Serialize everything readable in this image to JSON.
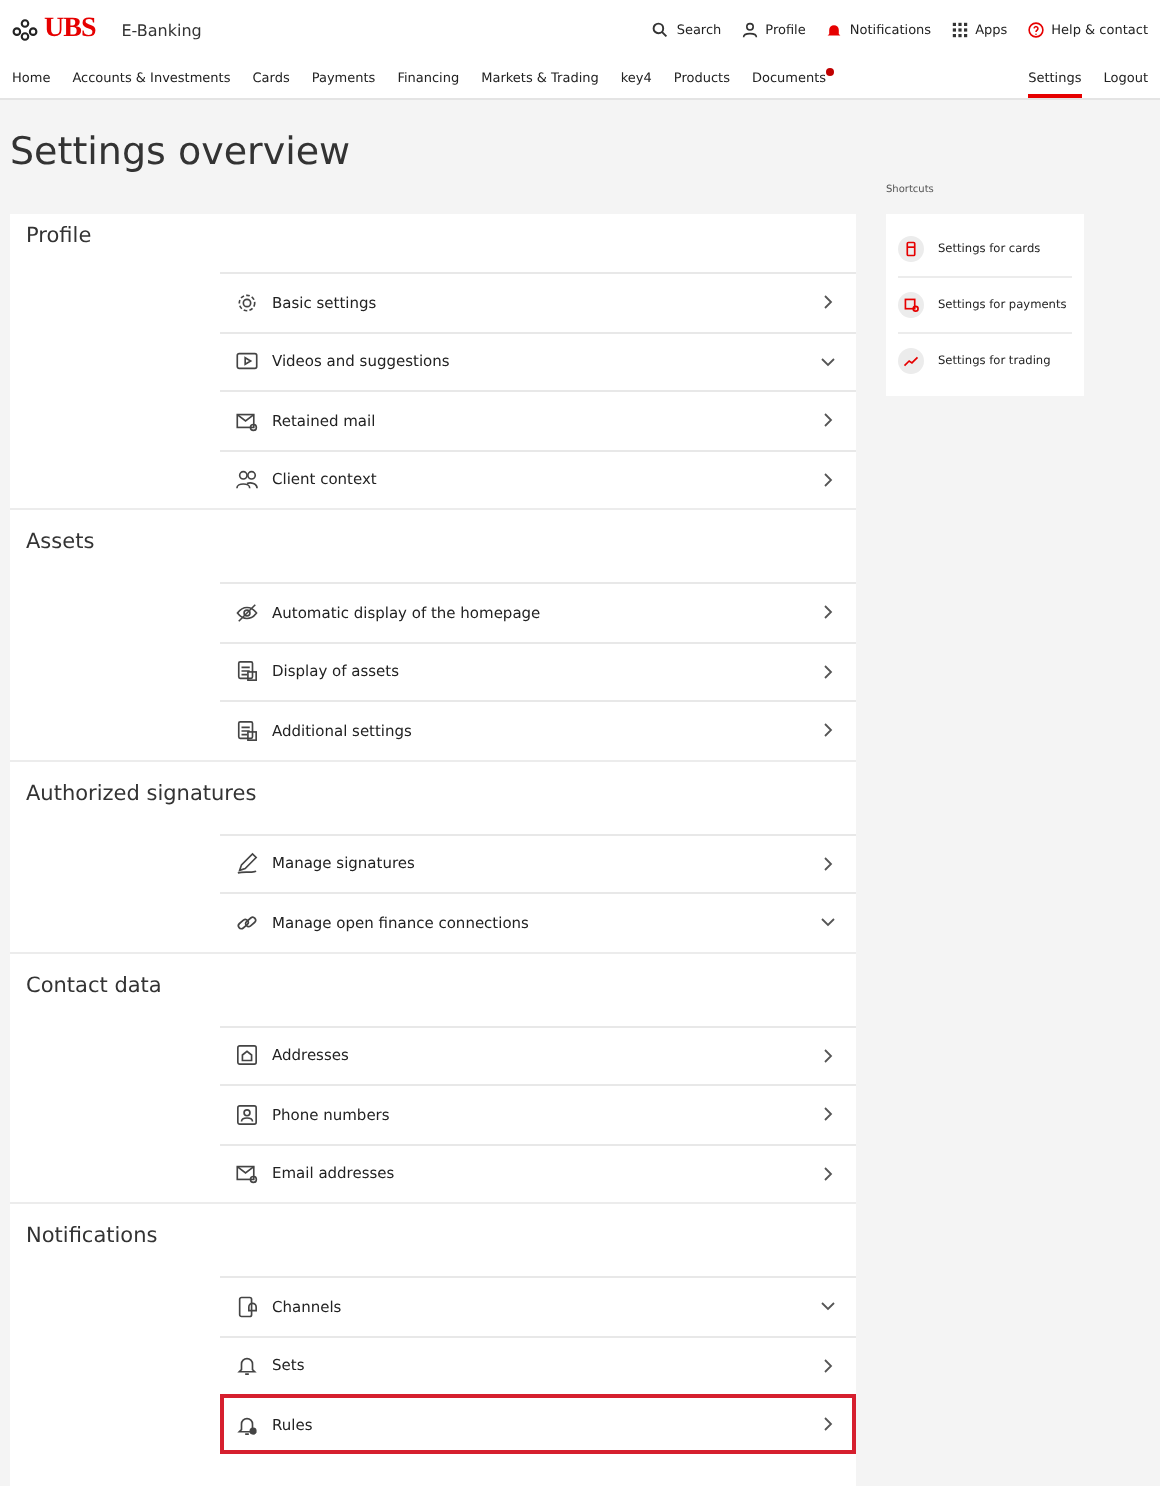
{
  "header": {
    "logo": "UBS",
    "product": "E-Banking",
    "actions": [
      {
        "label": "Search"
      },
      {
        "label": "Profile"
      },
      {
        "label": "Notifications"
      },
      {
        "label": "Apps"
      },
      {
        "label": "Help & contact"
      }
    ]
  },
  "nav": {
    "items": [
      {
        "label": "Home",
        "selected": false,
        "dot": false
      },
      {
        "label": "Accounts & Investments",
        "selected": false,
        "dot": false
      },
      {
        "label": "Cards",
        "selected": false,
        "dot": false
      },
      {
        "label": "Payments",
        "selected": false,
        "dot": false
      },
      {
        "label": "Financing",
        "selected": false,
        "dot": false
      },
      {
        "label": "Markets & Trading",
        "selected": false,
        "dot": false
      },
      {
        "label": "key4",
        "selected": false,
        "dot": false
      },
      {
        "label": "Products",
        "selected": false,
        "dot": false
      },
      {
        "label": "Documents",
        "selected": false,
        "dot": true
      }
    ],
    "right": [
      {
        "label": "Settings",
        "selected": true
      },
      {
        "label": "Logout",
        "selected": false
      }
    ]
  },
  "title": "Settings overview",
  "sections": [
    {
      "heading": "Profile",
      "items": [
        {
          "label": "Basic settings",
          "kind": "link",
          "highlighted": false
        },
        {
          "label": "Videos and suggestions",
          "kind": "expandable",
          "highlighted": false
        },
        {
          "label": "Retained mail",
          "kind": "link",
          "highlighted": false
        },
        {
          "label": "Client context",
          "kind": "link",
          "highlighted": false
        }
      ]
    },
    {
      "heading": "Assets",
      "items": [
        {
          "label": "Automatic display of the homepage",
          "kind": "link",
          "highlighted": false
        },
        {
          "label": "Display of assets",
          "kind": "link",
          "highlighted": false
        },
        {
          "label": "Additional settings",
          "kind": "link",
          "highlighted": false
        }
      ]
    },
    {
      "heading": "Authorized signatures",
      "items": [
        {
          "label": "Manage signatures",
          "kind": "link",
          "highlighted": false
        },
        {
          "label": "Manage open finance connections",
          "kind": "expandable",
          "highlighted": false
        }
      ]
    },
    {
      "heading": "Contact data",
      "items": [
        {
          "label": "Addresses",
          "kind": "link",
          "highlighted": false
        },
        {
          "label": "Phone numbers",
          "kind": "link",
          "highlighted": false
        },
        {
          "label": "Email addresses",
          "kind": "link",
          "highlighted": false
        }
      ]
    },
    {
      "heading": "Notifications",
      "items": [
        {
          "label": "Channels",
          "kind": "expandable",
          "highlighted": false
        },
        {
          "label": "Sets",
          "kind": "link",
          "highlighted": false
        },
        {
          "label": "Rules",
          "kind": "link",
          "highlighted": true
        }
      ]
    }
  ],
  "shortcuts": {
    "heading": "Shortcuts",
    "items": [
      {
        "label": "Settings for cards"
      },
      {
        "label": "Settings for payments"
      },
      {
        "label": "Settings for trading"
      }
    ]
  }
}
